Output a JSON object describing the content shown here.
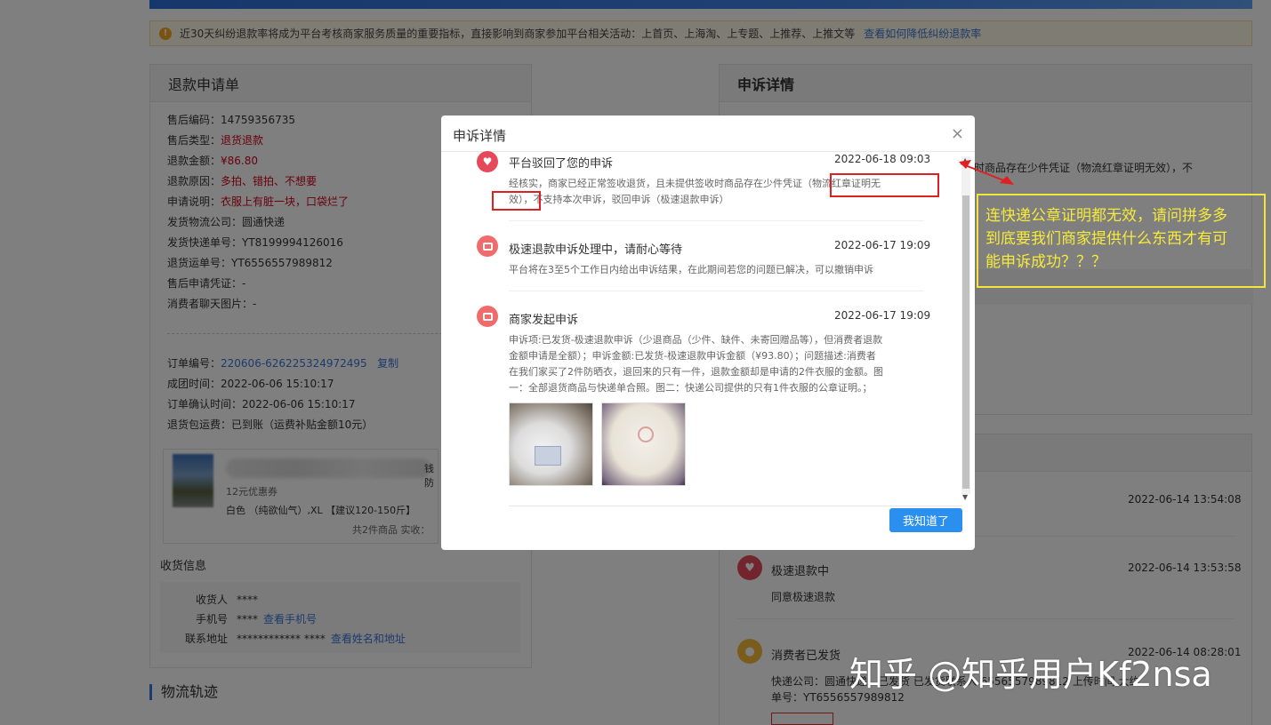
{
  "notice": {
    "text": "近30天纠纷退款率将成为平台考核商家服务质量的重要指标，直接影响到商家参加平台相关活动：上首页、上海淘、上专题、上推荐、上推文等",
    "link": "查看如何降低纠纷退款率"
  },
  "refund": {
    "title": "退款申请单",
    "after_sale_no": "售后编码：14759356735",
    "type_label": "售后类型：",
    "type_value": "退货退款",
    "amount_label": "退款金额：",
    "amount_value": "¥86.80",
    "reason_label": "退款原因：",
    "reason_value": "多拍、错拍、不想要",
    "desc_label": "申请说明：",
    "desc_value": "衣服上有脏一块，口袋烂了",
    "courier": "发货物流公司：圆通快递",
    "ship_no": "发货快递单号：YT8199994126016",
    "return_no": "退货运单号：YT6556557989812",
    "voucher": "售后申请凭证：-",
    "chat_img": "消费者聊天图片：-",
    "order_label": "订单编号：",
    "order_no": "220606-626225324972495",
    "copy": "复制",
    "group_time": "成团时间：2022-06-06 15:10:17",
    "confirm_time": "订单确认时间：2022-06-06 15:10:17",
    "return_ship": "退货包运费：已到账（运费补贴金额10元）",
    "coupon": "12元优惠券",
    "sku": "白色 （纯欲仙气）,XL 【建议120-150斤】",
    "total": "共2件商品   实收：",
    "partial": "钱防"
  },
  "receive": {
    "title": "收货信息",
    "name_label": "收货人",
    "name_value": "****",
    "phone_label": "手机号",
    "phone_value": "****",
    "phone_link": "查看手机号",
    "addr_label": "联系地址",
    "addr_value": "************ ****",
    "addr_link": "查看姓名和地址"
  },
  "logistics_title": "物流轨迹",
  "appeal_panel": {
    "title": "申诉详情",
    "bg_text": "时商品存在少件凭证（物流红章证明无效），不"
  },
  "timeline": {
    "t1_time": "2022-06-14 13:54:08",
    "t2_title": "极速退款中",
    "t2_desc": "同意极速退款",
    "t2_time": "2022-06-14 13:53:58",
    "t3_title": "消费者已发货",
    "t3_time": "2022-06-14 08:28:01",
    "t3_desc": "快递公司：圆通快递，已发货 已发货联系人   6556557989812  上传时间   大约",
    "t3_no": "单号：YT6556557989812"
  },
  "modal": {
    "title": "申诉详情",
    "close": "×",
    "e1_title": "平台驳回了您的申诉",
    "e1_time": "2022-06-18 09:03",
    "e1_line1": "经核实，商家已经正常签收退货，且未提供签收时商品存在少件凭证（物流红章证明无",
    "e1_line2": "效），不支持本次申诉，驳回申诉（极速退款申诉）",
    "e2_title": "极速退款申诉处理中，请耐心等待",
    "e2_time": "2022-06-17 19:09",
    "e2_desc": "平台将在3至5个工作日内给出申诉结果，在此期间若您的问题已解决，可以撤销申诉",
    "e3_title": "商家发起申诉",
    "e3_time": "2022-06-17 19:09",
    "e3_line1": "申诉项:已发货-极速退款申诉（少退商品（少件、缺件、未寄回赠品等），但消费者退款",
    "e3_line2": "金额申请是全额）；申诉金额:已发货-极速退款申诉金额（¥93.80）；问题描述:消费者",
    "e3_line3": "在我们家买了2件防晒衣，退回来的只有一件，退款金额却是申请的2件衣服的金额。图",
    "e3_line4": "一：全部退货商品与快递单合照。图二：快递公司提供的只有1件衣服的公章证明。；",
    "ok_button": "我知道了"
  },
  "annotation": {
    "line1": "连快递公章证明都无效，请问拼多多",
    "line2": "到底要我们商家提供什么东西才有可",
    "line3": "能申诉成功？？？"
  },
  "watermark": "知乎 @知乎用户Kf2nsa",
  "colors": {
    "accent": "#2b8ff0",
    "red": "#d0021b",
    "annotation": "#f3e53a"
  }
}
